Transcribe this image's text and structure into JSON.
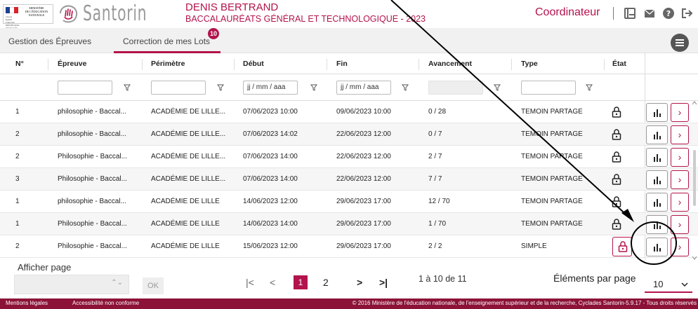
{
  "header": {
    "ministry_lines": [
      "MINISTÈRE",
      "DE L'ÉDUCATION",
      "NATIONALE"
    ],
    "motto": "Liberté · Égalité · Fraternité RÉPUBLIQUE FRANÇAISE",
    "app_name": "Santorin",
    "user_name": "DENIS BERTRAND",
    "exam_title": "BACCALAURÉATS GÉNÉRAL ET TECHNOLOGIQUE - 2023",
    "role": "Coordinateur",
    "icons": [
      "document-icon",
      "mail-icon",
      "help-icon",
      "logout-icon"
    ]
  },
  "tabs": [
    {
      "label": "Gestion des Épreuves",
      "active": false
    },
    {
      "label": "Correction de mes Lots",
      "active": true,
      "badge": "10"
    }
  ],
  "table": {
    "columns": [
      "N°",
      "Épreuve",
      "Périmètre",
      "Début",
      "Fin",
      "Avancement",
      "Type",
      "État"
    ],
    "filters": {
      "debut_placeholder": "jj / mm / aaa",
      "fin_placeholder": "jj / mm / aaa"
    },
    "rows": [
      {
        "num": "1",
        "epreuve": "philosophie - Baccal...",
        "perimetre": "ACADÉMIE DE LILLE...",
        "debut": "07/06/2023 10:00",
        "fin": "09/06/2023 10:00",
        "avancement": "0 / 28",
        "type": "TEMOIN PARTAGE",
        "etat": "locked"
      },
      {
        "num": "2",
        "epreuve": "philosophie - Baccal...",
        "perimetre": "ACADÉMIE DE LILLE...",
        "debut": "07/06/2023 14:02",
        "fin": "22/06/2023 12:00",
        "avancement": "0 / 7",
        "type": "TEMOIN PARTAGE",
        "etat": "locked"
      },
      {
        "num": "2",
        "epreuve": "Philosophie - Baccal...",
        "perimetre": "ACADÉMIE DE LILLE...",
        "debut": "07/06/2023 14:00",
        "fin": "22/06/2023 12:00",
        "avancement": "2 / 7",
        "type": "TEMOIN PARTAGE",
        "etat": "locked"
      },
      {
        "num": "3",
        "epreuve": "Philosophie - Baccal...",
        "perimetre": "ACADÉMIE DE LILLE...",
        "debut": "07/06/2023 14:00",
        "fin": "22/06/2023 12:00",
        "avancement": "7 / 7",
        "type": "TEMOIN PARTAGE",
        "etat": "locked"
      },
      {
        "num": "1",
        "epreuve": "philosophie - Baccal...",
        "perimetre": "ACADÉMIE DE LILLE",
        "debut": "14/06/2023 12:00",
        "fin": "29/06/2023 17:00",
        "avancement": "12 / 70",
        "type": "TEMOIN PARTAGE",
        "etat": "locked"
      },
      {
        "num": "1",
        "epreuve": "Philosophie - Baccal...",
        "perimetre": "ACADÉMIE DE LILLE",
        "debut": "14/06/2023 14:00",
        "fin": "29/06/2023 17:00",
        "avancement": "1 / 70",
        "type": "TEMOIN PARTAGE",
        "etat": "locked"
      },
      {
        "num": "2",
        "epreuve": "Philosophie - Baccal...",
        "perimetre": "ACADÉMIE DE LILLE",
        "debut": "15/06/2023 12:00",
        "fin": "29/06/2023 17:00",
        "avancement": "2 / 2",
        "type": "SIMPLE",
        "etat": "lock-button"
      }
    ]
  },
  "pager": {
    "afficher_label": "Afficher page",
    "ok_label": "OK",
    "first": "|<",
    "prev": "<",
    "pages": [
      "1",
      "2"
    ],
    "current_page": "1",
    "next": ">",
    "last": ">|",
    "range_text": "1 à 10 de 11",
    "per_page_label": "Éléments par page",
    "per_page_value": "10"
  },
  "footer": {
    "legal": "Mentions légales",
    "accessibility": "Accessibilité non conforme",
    "copyright": "© 2016 Ministère de l'éducation nationale, de l'enseignement supérieur et de la recherche, Cyclades Santorin-5.9.17 - Tous droits réservés"
  },
  "colors": {
    "accent": "#b3134c",
    "footer": "#8c1238",
    "annotation": "#000000"
  }
}
